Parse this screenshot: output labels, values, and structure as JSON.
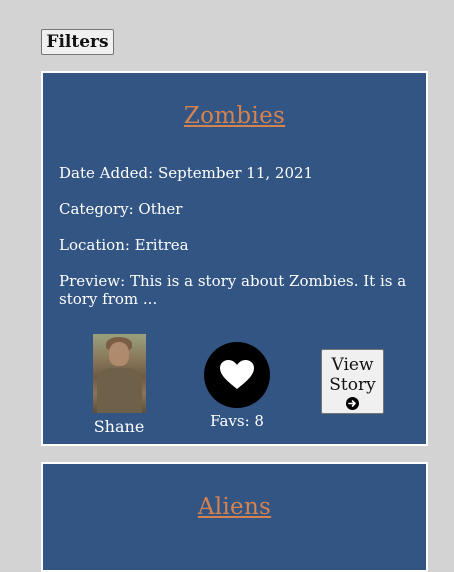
{
  "filters_label": "Filters",
  "colors": {
    "page_bg": "#d3d3d3",
    "card_bg": "#325583",
    "title_link": "#d4834f"
  },
  "stories": [
    {
      "title": "Zombies",
      "date_added": "Date Added: September 11, 2021",
      "category": "Category: Other",
      "location": "Location: Eritrea",
      "preview": "Preview: This is a story about Zombies. It is a story from ...",
      "author": "Shane",
      "favs": "Favs: 8",
      "view_line1": "View",
      "view_line2": "Story",
      "icons": {
        "favorite": "heart-icon",
        "view": "arrow-circle-right-icon"
      }
    },
    {
      "title": "Aliens"
    }
  ]
}
